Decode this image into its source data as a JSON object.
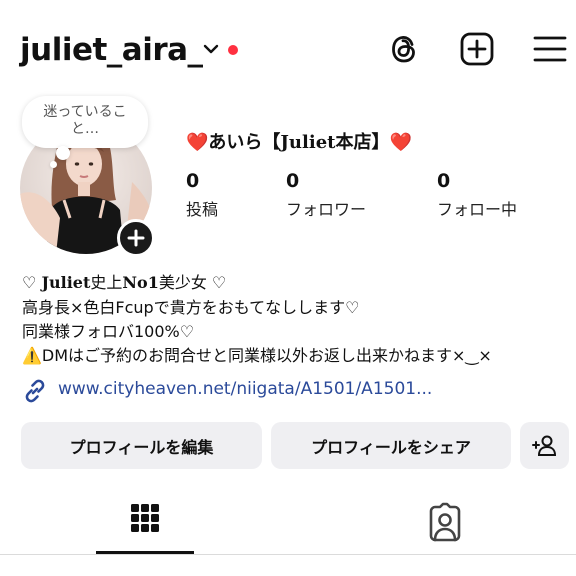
{
  "header": {
    "username": "juliet_aira_",
    "chevron_icon": "chevron-down-icon",
    "notification_dot_color": "#ff3040",
    "icons": [
      "threads-icon",
      "create-icon",
      "menu-icon"
    ]
  },
  "note": {
    "text": "迷っていること…"
  },
  "profile": {
    "display_name": "❤️あいら【Juliet本店】❤️",
    "stats": [
      {
        "value": "0",
        "label": "投稿"
      },
      {
        "value": "0",
        "label": "フォロワー"
      },
      {
        "value": "0",
        "label": "フォロー中"
      }
    ],
    "bio": {
      "line1_prefix": "♡ ",
      "line1_bold": "Juliet",
      "line1_rest": "史上",
      "line1_bold2": "No1",
      "line1_suffix": "美少女 ♡",
      "line2": "高身長×色白Fcupで貴方をおもてなしします♡",
      "line3": "同業様フォロバ100%♡",
      "line4": "⚠️DMはご予約のお問合せと同業様以外お返し出来かねます×‿×"
    },
    "link": "www.cityheaven.net/niigata/A1501/A1501..."
  },
  "buttons": {
    "edit_profile": "プロフィールを編集",
    "share_profile": "プロフィールをシェア",
    "discover_icon": "add-person-icon"
  },
  "tabs": {
    "active": "grid",
    "items": [
      "grid-icon",
      "tagged-icon"
    ]
  },
  "colors": {
    "link": "#2b4a9a",
    "button_bg": "#efeff2",
    "text": "#111111"
  }
}
